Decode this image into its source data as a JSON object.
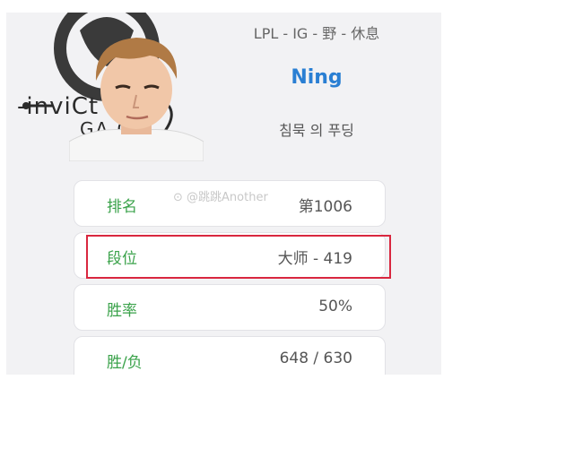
{
  "header": {
    "meta": "LPL - IG - 野 - 休息",
    "player_name": "Ning",
    "nickname": "침묵 의 푸딩"
  },
  "logo": {
    "wordmark_top": "-inviCt",
    "wordmark_bottom": "GA   G"
  },
  "watermark": "⊙ @跳跳Another",
  "stats": [
    {
      "label": "排名",
      "value": "第1006"
    },
    {
      "label": "段位",
      "value": "大师 - 419"
    },
    {
      "label": "胜率",
      "value": "50%"
    },
    {
      "label": "胜/负",
      "value": "648 / 630"
    }
  ],
  "colors": {
    "label_green": "#3aa24a",
    "name_blue": "#2a7fd3",
    "highlight_red": "#d9273f"
  }
}
